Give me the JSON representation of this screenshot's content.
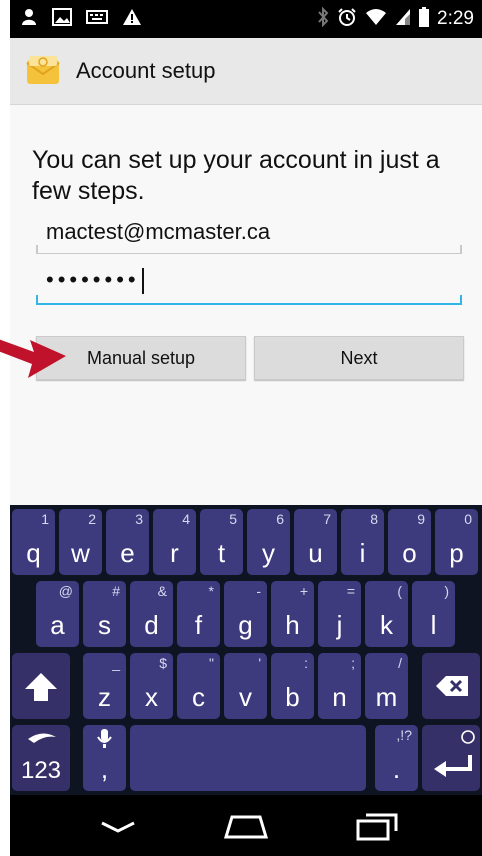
{
  "status_bar": {
    "time": "2:29"
  },
  "app_bar": {
    "title": "Account setup"
  },
  "content": {
    "intro_text": "You can set up your account in just a few steps.",
    "email_value": "mactest@mcmaster.ca",
    "password_value": "••••••••",
    "manual_setup_label": "Manual setup",
    "next_label": "Next"
  },
  "keyboard": {
    "row1": [
      {
        "key": "q",
        "sub": "1"
      },
      {
        "key": "w",
        "sub": "2"
      },
      {
        "key": "e",
        "sub": "3"
      },
      {
        "key": "r",
        "sub": "4"
      },
      {
        "key": "t",
        "sub": "5"
      },
      {
        "key": "y",
        "sub": "6"
      },
      {
        "key": "u",
        "sub": "7"
      },
      {
        "key": "i",
        "sub": "8"
      },
      {
        "key": "o",
        "sub": "9"
      },
      {
        "key": "p",
        "sub": "0"
      }
    ],
    "row2": [
      {
        "key": "a",
        "sub": "@"
      },
      {
        "key": "s",
        "sub": "#"
      },
      {
        "key": "d",
        "sub": "&"
      },
      {
        "key": "f",
        "sub": "*"
      },
      {
        "key": "g",
        "sub": "-"
      },
      {
        "key": "h",
        "sub": "+"
      },
      {
        "key": "j",
        "sub": "="
      },
      {
        "key": "k",
        "sub": "("
      },
      {
        "key": "l",
        "sub": ")"
      }
    ],
    "row3": [
      {
        "key": "z",
        "sub": "_"
      },
      {
        "key": "x",
        "sub": "$"
      },
      {
        "key": "c",
        "sub": "\""
      },
      {
        "key": "v",
        "sub": "'"
      },
      {
        "key": "b",
        "sub": ":"
      },
      {
        "key": "n",
        "sub": ";"
      },
      {
        "key": "m",
        "sub": "/"
      }
    ],
    "numbers_label": "123",
    "comma_label": ",",
    "period_label": ".",
    "period_sub": ",!?"
  },
  "icons": [
    "notification-icon",
    "image-icon",
    "keyboard-icon",
    "warning-icon",
    "bluetooth-icon",
    "alarm-icon",
    "wifi-icon",
    "signal-icon",
    "battery-icon",
    "email-app-icon",
    "shift-icon",
    "backspace-icon",
    "swype-icon",
    "microphone-icon",
    "emoji-icon",
    "enter-icon",
    "back-icon",
    "home-icon",
    "recents-icon"
  ]
}
